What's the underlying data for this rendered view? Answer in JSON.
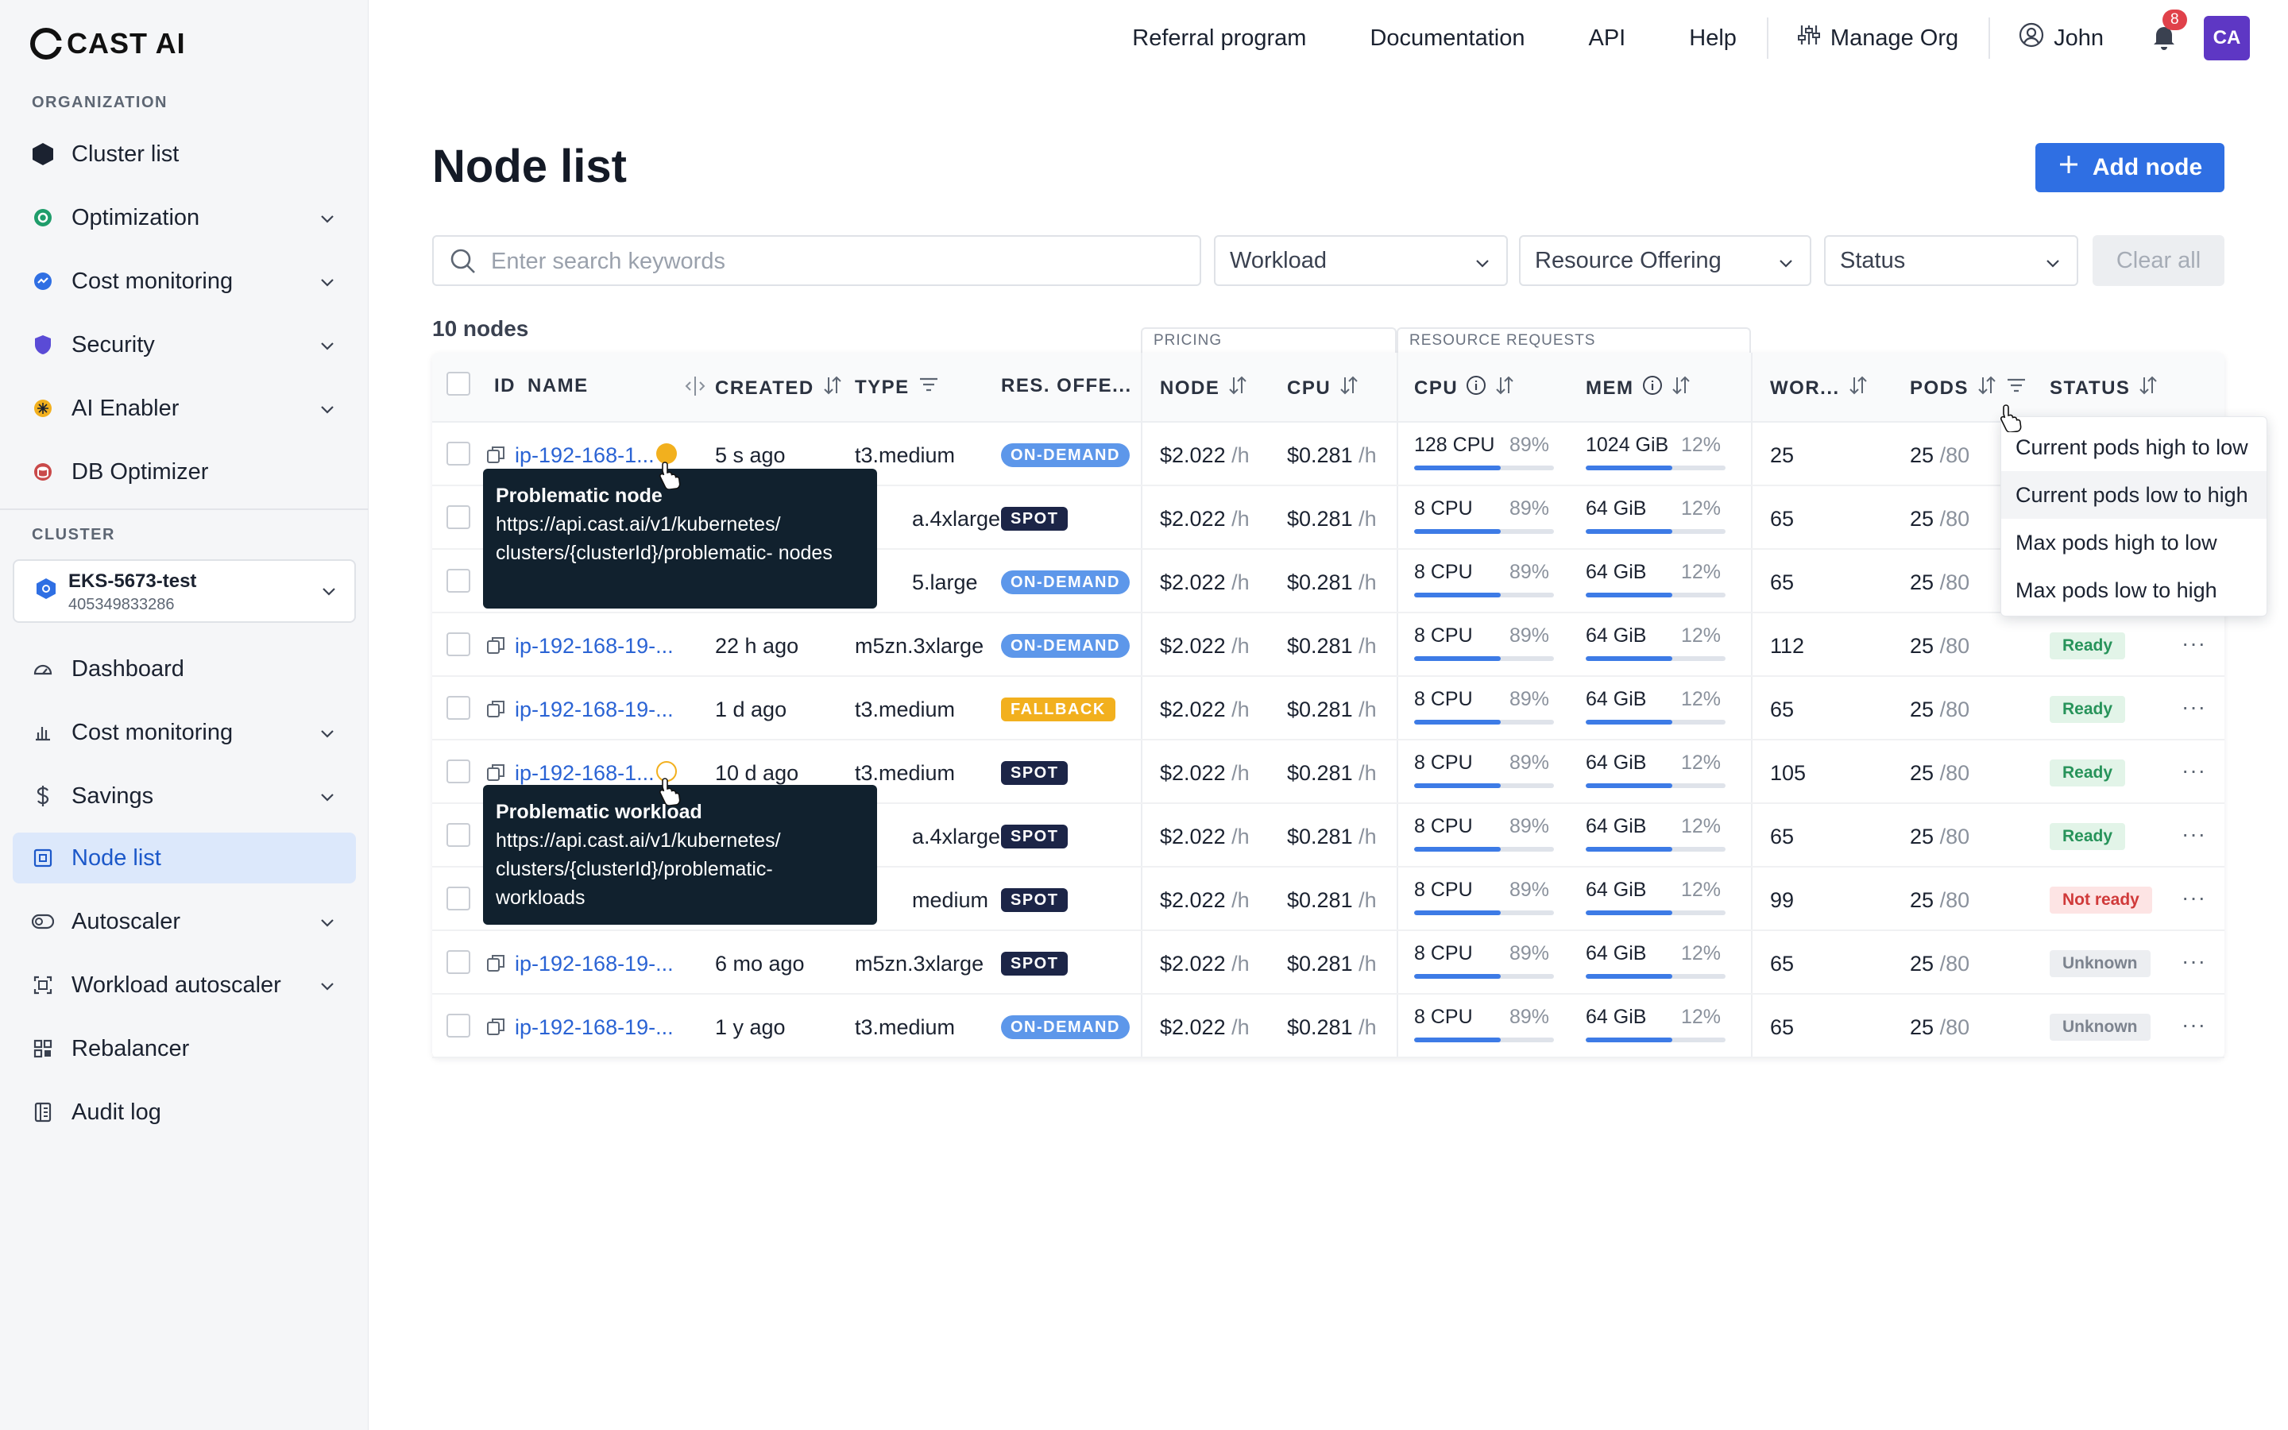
{
  "brand": {
    "name": "CAST AI"
  },
  "sidebar": {
    "org_label": "ORGANIZATION",
    "org_items": [
      {
        "label": "Cluster list",
        "icon": "hexagon-icon"
      },
      {
        "label": "Optimization",
        "icon": "optimization-icon"
      },
      {
        "label": "Cost monitoring",
        "icon": "cost-monitoring-icon"
      },
      {
        "label": "Security",
        "icon": "shield-icon"
      },
      {
        "label": "AI Enabler",
        "icon": "ai-enabler-icon"
      },
      {
        "label": "DB Optimizer",
        "icon": "database-icon"
      }
    ],
    "cluster_label": "CLUSTER",
    "cluster": {
      "name": "EKS-5673-test",
      "id": "405349833286"
    },
    "cluster_items": [
      {
        "label": "Dashboard",
        "icon": "gauge-icon"
      },
      {
        "label": "Cost monitoring",
        "icon": "bar-chart-icon"
      },
      {
        "label": "Savings",
        "icon": "dollar-icon"
      },
      {
        "label": "Node list",
        "icon": "node-icon"
      },
      {
        "label": "Autoscaler",
        "icon": "toggle-icon"
      },
      {
        "label": "Workload autoscaler",
        "icon": "workload-icon"
      },
      {
        "label": "Rebalancer",
        "icon": "grid-icon"
      },
      {
        "label": "Audit log",
        "icon": "audit-log-icon"
      }
    ]
  },
  "topnav": {
    "referral": "Referral program",
    "docs": "Documentation",
    "api": "API",
    "help": "Help",
    "manage": "Manage Org",
    "user": "John",
    "notif_count": "8",
    "avatar": "CA"
  },
  "page": {
    "title": "Node list",
    "add_button": "Add node",
    "search_placeholder": "Enter search keywords",
    "filters": {
      "workload": "Workload",
      "offering": "Resource Offering",
      "status": "Status"
    },
    "clear": "Clear all",
    "count": "10 nodes"
  },
  "table": {
    "groups": {
      "pricing": "PRICING",
      "resources": "RESOURCE REQUESTS"
    },
    "headers": {
      "id": "ID",
      "name": "NAME",
      "created": "CREATED",
      "type": "TYPE",
      "offering": "RES. OFFE...",
      "node": "NODE",
      "cpu_price": "CPU",
      "cpu_req": "CPU",
      "mem_req": "MEM",
      "workloads": "WOR...",
      "pods": "PODS",
      "status": "STATUS"
    },
    "price_unit": "/h",
    "rows": [
      {
        "name": "ip-192-168-1...",
        "warn": "filled",
        "created": "5 s ago",
        "type": "t3.medium",
        "offering": "ON-DEMAND",
        "offering_kind": "ondemand",
        "node_price": "$2.022",
        "cpu_price": "$0.281",
        "cpu": "128 CPU",
        "cpu_pct": "89%",
        "cpu_fill": 0.62,
        "mem": "1024 GiB",
        "mem_pct": "12%",
        "mem_fill": 0.62,
        "workloads": "25",
        "pods": "25",
        "pods_max": "/80",
        "status": "",
        "status_kind": ""
      },
      {
        "name": "",
        "warn": "",
        "created": "",
        "type": "a.4xlarge",
        "offering": "SPOT",
        "offering_kind": "spot",
        "node_price": "$2.022",
        "cpu_price": "$0.281",
        "cpu": "8 CPU",
        "cpu_pct": "89%",
        "cpu_fill": 0.62,
        "mem": "64 GiB",
        "mem_pct": "12%",
        "mem_fill": 0.62,
        "workloads": "65",
        "pods": "25",
        "pods_max": "/80",
        "status": "",
        "status_kind": ""
      },
      {
        "name": "",
        "warn": "",
        "created": "",
        "type": "5.large",
        "offering": "ON-DEMAND",
        "offering_kind": "ondemand",
        "node_price": "$2.022",
        "cpu_price": "$0.281",
        "cpu": "8 CPU",
        "cpu_pct": "89%",
        "cpu_fill": 0.62,
        "mem": "64 GiB",
        "mem_pct": "12%",
        "mem_fill": 0.62,
        "workloads": "65",
        "pods": "25",
        "pods_max": "/80",
        "status": "",
        "status_kind": ""
      },
      {
        "name": "ip-192-168-19-...",
        "warn": "",
        "created": "22 h ago",
        "type": "m5zn.3xlarge",
        "offering": "ON-DEMAND",
        "offering_kind": "ondemand",
        "node_price": "$2.022",
        "cpu_price": "$0.281",
        "cpu": "8 CPU",
        "cpu_pct": "89%",
        "cpu_fill": 0.62,
        "mem": "64 GiB",
        "mem_pct": "12%",
        "mem_fill": 0.62,
        "workloads": "112",
        "pods": "25",
        "pods_max": "/80",
        "status": "Ready",
        "status_kind": "ready"
      },
      {
        "name": "ip-192-168-19-...",
        "warn": "",
        "created": "1 d ago",
        "type": "t3.medium",
        "offering": "FALLBACK",
        "offering_kind": "fallback",
        "node_price": "$2.022",
        "cpu_price": "$0.281",
        "cpu": "8 CPU",
        "cpu_pct": "89%",
        "cpu_fill": 0.62,
        "mem": "64 GiB",
        "mem_pct": "12%",
        "mem_fill": 0.62,
        "workloads": "65",
        "pods": "25",
        "pods_max": "/80",
        "status": "Ready",
        "status_kind": "ready"
      },
      {
        "name": "ip-192-168-1...",
        "warn": "outline",
        "created": "10 d ago",
        "type": "t3.medium",
        "offering": "SPOT",
        "offering_kind": "spot",
        "node_price": "$2.022",
        "cpu_price": "$0.281",
        "cpu": "8 CPU",
        "cpu_pct": "89%",
        "cpu_fill": 0.62,
        "mem": "64 GiB",
        "mem_pct": "12%",
        "mem_fill": 0.62,
        "workloads": "105",
        "pods": "25",
        "pods_max": "/80",
        "status": "Ready",
        "status_kind": "ready"
      },
      {
        "name": "",
        "warn": "",
        "created": "",
        "type": "a.4xlarge",
        "offering": "SPOT",
        "offering_kind": "spot",
        "node_price": "$2.022",
        "cpu_price": "$0.281",
        "cpu": "8 CPU",
        "cpu_pct": "89%",
        "cpu_fill": 0.62,
        "mem": "64 GiB",
        "mem_pct": "12%",
        "mem_fill": 0.62,
        "workloads": "65",
        "pods": "25",
        "pods_max": "/80",
        "status": "Ready",
        "status_kind": "ready"
      },
      {
        "name": "",
        "warn": "",
        "created": "",
        "type": "medium",
        "offering": "SPOT",
        "offering_kind": "spot",
        "node_price": "$2.022",
        "cpu_price": "$0.281",
        "cpu": "8 CPU",
        "cpu_pct": "89%",
        "cpu_fill": 0.62,
        "mem": "64 GiB",
        "mem_pct": "12%",
        "mem_fill": 0.62,
        "workloads": "99",
        "pods": "25",
        "pods_max": "/80",
        "status": "Not ready",
        "status_kind": "notready"
      },
      {
        "name": "ip-192-168-19-...",
        "warn": "",
        "created": "6 mo ago",
        "type": "m5zn.3xlarge",
        "offering": "SPOT",
        "offering_kind": "spot",
        "node_price": "$2.022",
        "cpu_price": "$0.281",
        "cpu": "8 CPU",
        "cpu_pct": "89%",
        "cpu_fill": 0.62,
        "mem": "64 GiB",
        "mem_pct": "12%",
        "mem_fill": 0.62,
        "workloads": "65",
        "pods": "25",
        "pods_max": "/80",
        "status": "Unknown",
        "status_kind": "unknown"
      },
      {
        "name": "ip-192-168-19-...",
        "warn": "",
        "created": "1 y ago",
        "type": "t3.medium",
        "offering": "ON-DEMAND",
        "offering_kind": "ondemand",
        "node_price": "$2.022",
        "cpu_price": "$0.281",
        "cpu": "8 CPU",
        "cpu_pct": "89%",
        "cpu_fill": 0.62,
        "mem": "64 GiB",
        "mem_pct": "12%",
        "mem_fill": 0.62,
        "workloads": "65",
        "pods": "25",
        "pods_max": "/80",
        "status": "Unknown",
        "status_kind": "unknown"
      }
    ]
  },
  "tooltips": [
    {
      "title": "Problematic node",
      "text": "https://api.cast.ai/v1/kubernetes/ clusters/{clusterId}/problematic- nodes"
    },
    {
      "title": "Problematic workload",
      "text": "https://api.cast.ai/v1/kubernetes/ clusters/{clusterId}/problematic- workloads"
    }
  ],
  "sort_menu": [
    "Current pods high to low",
    "Current pods low to high",
    "Max pods high to low",
    "Max pods low to high"
  ]
}
